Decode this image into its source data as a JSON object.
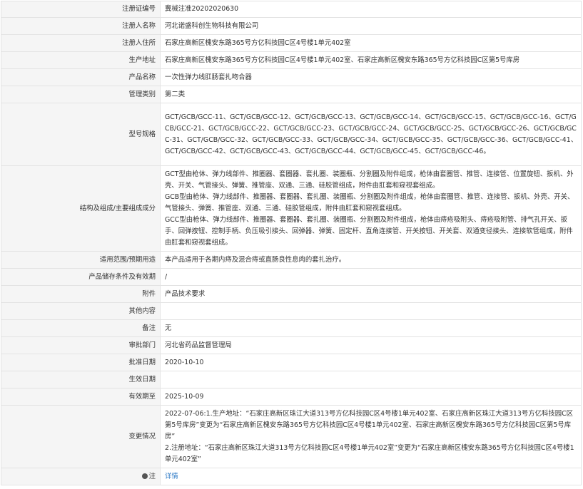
{
  "rows": [
    {
      "label": "注册证编号",
      "value": "冀械注准20202020630"
    },
    {
      "label": "注册人名称",
      "value": "河北诺盛科创生物科技有限公司"
    },
    {
      "label": "注册人住所",
      "value": "石家庄高新区槐安东路365号方亿科技园C区4号楼1单元402室"
    },
    {
      "label": "生产地址",
      "value": "石家庄高新区槐安东路365号方亿科技园C区4号楼1单元402室、石家庄高新区槐安东路365号方亿科技园C区第5号库房"
    },
    {
      "label": "产品名称",
      "value": "一次性弹力线肛肠套扎吻合器"
    },
    {
      "label": "管理类别",
      "value": "第二类"
    },
    {
      "label": "型号规格",
      "value": "GCT/GCB/GCC-11、GCT/GCB/GCC-12、GCT/GCB/GCC-13、GCT/GCB/GCC-14、GCT/GCB/GCC-15、GCT/GCB/GCC-16、GCT/GCB/GCC-21、GCT/GCB/GCC-22、GCT/GCB/GCC-23、GCT/GCB/GCC-24、GCT/GCB/GCC-25、GCT/GCB/GCC-26、GCT/GCB/GCC-31、GCT/GCB/GCC-32、GCT/GCB/GCC-33、GCT/GCB/GCC-34、GCT/GCB/GCC-35、GCT/GCB/GCC-36、GCT/GCB/GCC-41、GCT/GCB/GCC-42、GCT/GCB/GCC-43、GCT/GCB/GCC-44、GCT/GCB/GCC-45、GCT/GCB/GCC-46。"
    },
    {
      "label": "结构及组成/主要组成成分",
      "paragraphs": [
        "GCT型由枪体、弹力线部件、推圈器、套圈器、套扎圈、装圈瓶、分割圈及附件组成，枪体由套圈管、推管、连接管、位置旋钮、扳机、外壳、开关、气管接头、弹簧、推管座、双通、三通、硅胶管组成，附件由肛套和窥视套组成。",
        "GCB型由枪体、弹力线部件、推圈器、套圈器、套扎圈、装圈瓶、分割圈及附件组成，枪体由套圈管、推管、连接管、扳机、外壳、开关、气管接头、弹簧、推管座、双通、三通、硅胶管组成，附件由肛套和窥视套组成。",
        "GCC型由枪体、弹力线部件、推圈器、套圈器、套扎圈、装圈瓶、分割圈及附件组成，枪体由痔疮吸附头、痔疮吸附管、排气孔开关、扳手、回弹按钮、控制手柄、负压吸引接头、回弹器、弹簧、固定杆、直角连接管、开关按钮、开关套、双通变径接头、连接软管组成，附件由肛套和窥视套组成。"
      ]
    },
    {
      "label": "适用范围/预期用途",
      "value": "本产品适用于各期内痔及混合痔或直肠良性息肉的套扎治疗。"
    },
    {
      "label": "产品储存条件及有效期",
      "value": "/"
    },
    {
      "label": "附件",
      "value": "产品技术要求"
    },
    {
      "label": "其他内容",
      "value": ""
    },
    {
      "label": "备注",
      "value": "无"
    },
    {
      "label": "审批部门",
      "value": "河北省药品监督管理局"
    },
    {
      "label": "批准日期",
      "value": "2020-10-10"
    },
    {
      "label": "生效日期",
      "value": ""
    },
    {
      "label": "有效期至",
      "value": "2025-10-09"
    },
    {
      "label": "变更情况",
      "paragraphs": [
        "2022-07-06:1.生产地址：“石家庄高新区珠江大道313号方亿科技园C区4号楼1单元402室、石家庄高新区珠江大道313号方亿科技园C区第5号库房”变更为“石家庄高新区槐安东路365号方亿科技园C区4号楼1单元402室、石家庄高新区槐安东路365号方亿科技园C区第5号库房”",
        "2.注册地址：“石家庄高新区珠江大道313号方亿科技园C区4号楼1单元402室”变更为“石家庄高新区槐安东路365号方亿科技园C区4号楼1单元402室”"
      ]
    },
    {
      "label": "注",
      "value": "详情",
      "icon": "info-dot-icon",
      "link": true
    }
  ]
}
